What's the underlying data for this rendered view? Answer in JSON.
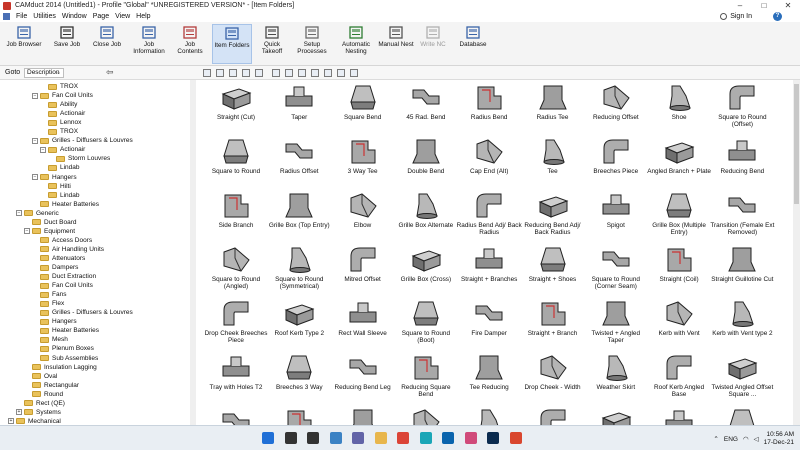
{
  "window": {
    "title": "CAMduct 2014 (Untitled1) - Profile \"Global\" *UNREGISTERED VERSION* - [Item Folders]",
    "controls": [
      "–",
      "□",
      "✕"
    ]
  },
  "menu": {
    "items": [
      "File",
      "Utilities",
      "Window",
      "Page",
      "View",
      "Help"
    ],
    "sign_in": "Sign In",
    "help_icon": "?"
  },
  "ribbon": {
    "buttons": [
      {
        "label": "Job Browser",
        "icon": "job-browser-icon",
        "state": "normal"
      },
      {
        "label": "Save Job",
        "icon": "save-icon",
        "state": "normal"
      },
      {
        "label": "Close Job",
        "icon": "close-job-icon",
        "state": "normal"
      },
      {
        "label": "Job\nInformation",
        "icon": "job-info-icon",
        "state": "normal"
      },
      {
        "label": "Job\nContents",
        "icon": "job-contents-icon",
        "state": "normal"
      },
      {
        "label": "Item Folders",
        "icon": "item-folders-icon",
        "state": "active"
      },
      {
        "label": "Quick\nTakeoff",
        "icon": "quick-takeoff-icon",
        "state": "normal"
      },
      {
        "label": "Setup\nProcesses",
        "icon": "setup-processes-icon",
        "state": "normal"
      },
      {
        "label": "Automatic\nNesting",
        "icon": "automatic-nesting-icon",
        "state": "normal"
      },
      {
        "label": "Manual Nest",
        "icon": "manual-nest-icon",
        "state": "normal"
      },
      {
        "label": "Write NC",
        "icon": "write-nc-icon",
        "state": "disabled"
      },
      {
        "label": "Database",
        "icon": "database-icon",
        "state": "normal"
      }
    ]
  },
  "toolbar": {
    "goto_label": "Goto",
    "field_value": "Description",
    "dropdown_arrow": "⌄",
    "go_arrow": "⇦"
  },
  "tree": {
    "rows": [
      {
        "level": 4,
        "label": "TROX",
        "expander": ""
      },
      {
        "level": 3,
        "label": "Fan Coil Units",
        "expander": "−"
      },
      {
        "level": 4,
        "label": "Ability",
        "expander": ""
      },
      {
        "level": 4,
        "label": "Actionair",
        "expander": ""
      },
      {
        "level": 4,
        "label": "Lennox",
        "expander": ""
      },
      {
        "level": 4,
        "label": "TROX",
        "expander": ""
      },
      {
        "level": 3,
        "label": "Grilles - Diffusers & Louvres",
        "expander": "−"
      },
      {
        "level": 4,
        "label": "Actionair",
        "expander": "−"
      },
      {
        "level": 5,
        "label": "Storm Louvres",
        "expander": ""
      },
      {
        "level": 4,
        "label": "Lindab",
        "expander": ""
      },
      {
        "level": 3,
        "label": "Hangers",
        "expander": "−"
      },
      {
        "level": 4,
        "label": "Hilti",
        "expander": ""
      },
      {
        "level": 4,
        "label": "Lindab",
        "expander": ""
      },
      {
        "level": 3,
        "label": "Heater Batteries",
        "expander": ""
      },
      {
        "level": 1,
        "label": "Generic",
        "expander": "−"
      },
      {
        "level": 2,
        "label": "Duct Board",
        "expander": ""
      },
      {
        "level": 2,
        "label": "Equipment",
        "expander": "−"
      },
      {
        "level": 3,
        "label": "Access Doors",
        "expander": ""
      },
      {
        "level": 3,
        "label": "Air Handling Units",
        "expander": ""
      },
      {
        "level": 3,
        "label": "Attenuators",
        "expander": ""
      },
      {
        "level": 3,
        "label": "Dampers",
        "expander": ""
      },
      {
        "level": 3,
        "label": "Duct Extraction",
        "expander": ""
      },
      {
        "level": 3,
        "label": "Fan Coil Units",
        "expander": ""
      },
      {
        "level": 3,
        "label": "Fans",
        "expander": ""
      },
      {
        "level": 3,
        "label": "Flex",
        "expander": ""
      },
      {
        "level": 3,
        "label": "Grilles - Diffusers & Louvres",
        "expander": ""
      },
      {
        "level": 3,
        "label": "Hangers",
        "expander": ""
      },
      {
        "level": 3,
        "label": "Heater Batteries",
        "expander": ""
      },
      {
        "level": 3,
        "label": "Mesh",
        "expander": ""
      },
      {
        "level": 3,
        "label": "Plenum Boxes",
        "expander": ""
      },
      {
        "level": 3,
        "label": "Sub Assemblies",
        "expander": ""
      },
      {
        "level": 2,
        "label": "Insulation Lagging",
        "expander": ""
      },
      {
        "level": 2,
        "label": "Oval",
        "expander": ""
      },
      {
        "level": 2,
        "label": "Rectangular",
        "expander": ""
      },
      {
        "level": 2,
        "label": "Round",
        "expander": ""
      },
      {
        "level": 1,
        "label": "Rect (QE)",
        "expander": ""
      },
      {
        "level": 1,
        "label": "Systems",
        "expander": "+"
      },
      {
        "level": 0,
        "label": "Mechanical",
        "expander": "+"
      }
    ]
  },
  "gallery": {
    "items": [
      "Straight (Cut)",
      "Taper",
      "Square Bend",
      "45 Rad. Bend",
      "Radius Bend",
      "Radius Tee",
      "Reducing Offset",
      "Shoe",
      "Square to Round (Offset)",
      "Square to Round",
      "Radius Offset",
      "3 Way Tee",
      "Double Bend",
      "Cap End (Alt)",
      "Tee",
      "Breeches Piece",
      "Angled Branch + Plate",
      "Reducing Bend",
      "Side Branch",
      "Grille Box (Top Entry)",
      "Elbow",
      "Grille Box Alternate",
      "Radius Bend Adj/ Back Radius",
      "Reducing Bend Adj/ Back Radius",
      "Spigot",
      "Grille Box (Multiple Entry)",
      "Transition (Female Ext Removed)",
      "Square to Round (Angled)",
      "Square to Round (Symmetrical)",
      "Mitred Offset",
      "Grille Box (Cross)",
      "Straight + Branches",
      "Straight + Shoes",
      "Square to Round (Corner Seam)",
      "Straight (Coil)",
      "Straight Guillotine Cut",
      "Drop Cheek Breeches Piece",
      "Roof Kerb Type 2",
      "Rect Wall Sleeve",
      "Square to Round (Boot)",
      "Fire Damper",
      "Straight + Branch",
      "Twisted + Angled Taper",
      "Kerb with Vent",
      "Kerb with Vent type 2",
      "Tray with Holes T2",
      "Breeches 3 Way",
      "Reducing Bend Leg",
      "Reducing Square Bend",
      "Tee Reducing",
      "Drop Cheek - Width",
      "Weather Skirt",
      "Roof Kerb Angled Base",
      "Twisted Angled Offset Square ...",
      "",
      "",
      "",
      "",
      "",
      "",
      "",
      "",
      ""
    ]
  },
  "taskbar": {
    "apps": [
      {
        "icon": "start-icon",
        "color": "#1f6fd6"
      },
      {
        "icon": "search-icon",
        "color": "#333333"
      },
      {
        "icon": "task-view-icon",
        "color": "#333333"
      },
      {
        "icon": "widgets-icon",
        "color": "#3b82c4"
      },
      {
        "icon": "teams-icon",
        "color": "#6264a7"
      },
      {
        "icon": "explorer-icon",
        "color": "#e8b64c"
      },
      {
        "icon": "chrome-icon",
        "color": "#db4437"
      },
      {
        "icon": "edge-icon",
        "color": "#1aa6b7"
      },
      {
        "icon": "mail-icon",
        "color": "#0a64ad"
      },
      {
        "icon": "photos-icon",
        "color": "#d04a7a"
      },
      {
        "icon": "photoshop-icon",
        "color": "#0b2b4f"
      },
      {
        "icon": "camduct-icon",
        "color": "#d9462e"
      }
    ],
    "language": "ENG",
    "time": "10:56 AM",
    "date": "17-Dec-21"
  }
}
